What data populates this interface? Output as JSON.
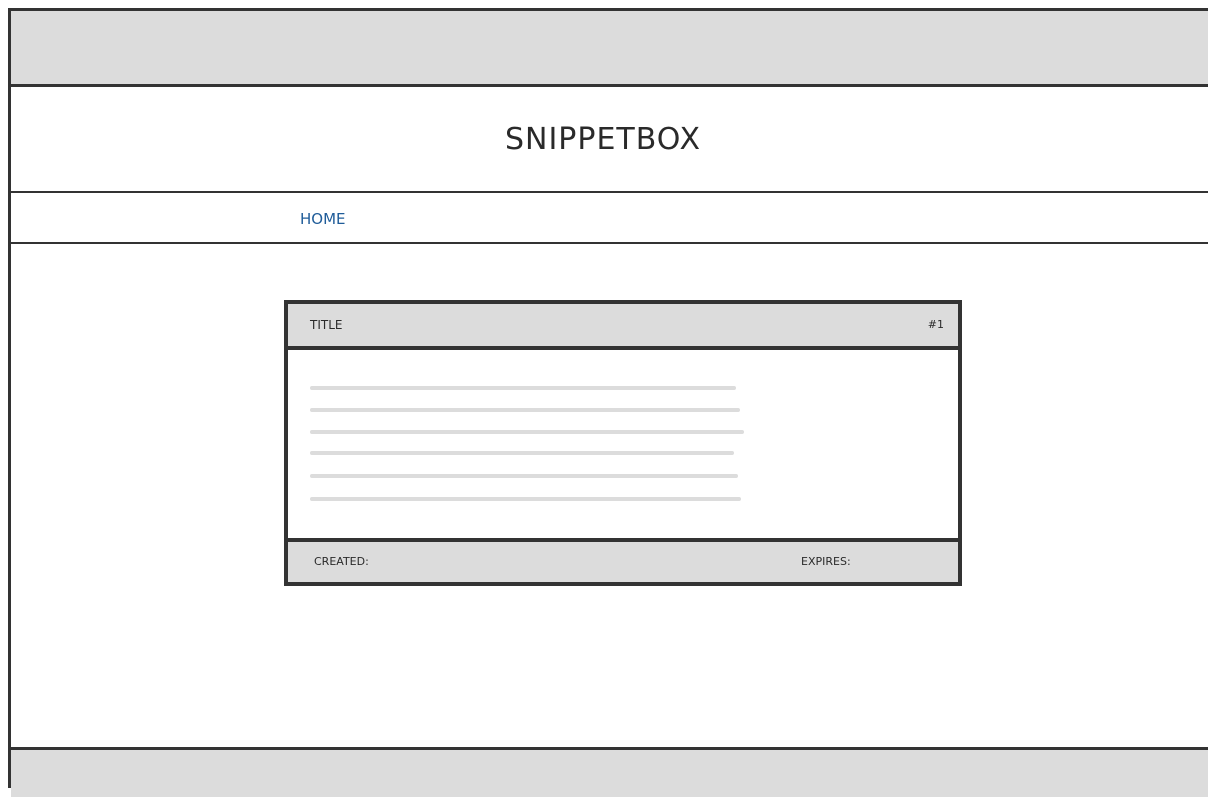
{
  "header": {
    "title": "SNIPPETBOX"
  },
  "nav": {
    "home_label": "HOME"
  },
  "snippet": {
    "title": "TITLE",
    "id": "#1",
    "created_label": "CREATED:",
    "expires_label": "EXPIRES:"
  },
  "colors": {
    "link": "#1f5c99",
    "panel": "#dcdcdc",
    "border": "#333333"
  }
}
